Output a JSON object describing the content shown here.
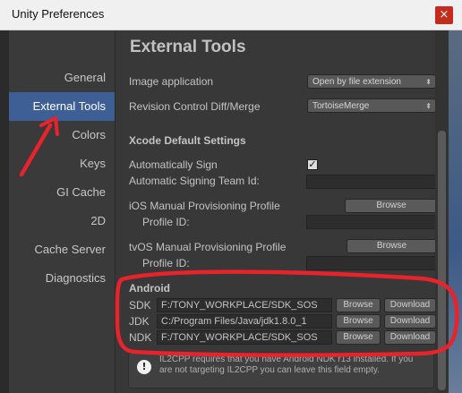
{
  "window": {
    "title": "Unity Preferences",
    "close_glyph": "×"
  },
  "sidebar": {
    "items": [
      {
        "label": "General",
        "selected": false
      },
      {
        "label": "External Tools",
        "selected": true
      },
      {
        "label": "Colors",
        "selected": false
      },
      {
        "label": "Keys",
        "selected": false
      },
      {
        "label": "GI Cache",
        "selected": false
      },
      {
        "label": "2D",
        "selected": false
      },
      {
        "label": "Cache Server",
        "selected": false
      },
      {
        "label": "Diagnostics",
        "selected": false
      }
    ]
  },
  "main": {
    "title": "External Tools",
    "image_application": {
      "label": "Image application",
      "value": "Open by file extension"
    },
    "revision_control": {
      "label": "Revision Control Diff/Merge",
      "value": "TortoiseMerge"
    },
    "xcode": {
      "heading": "Xcode Default Settings",
      "auto_sign_label": "Automatically Sign",
      "auto_sign_checked": true,
      "check_glyph": "✓",
      "team_id_label": "Automatic Signing Team Id:",
      "team_id_value": "",
      "ios_profile_label": "iOS Manual Provisioning Profile",
      "ios_profile_id_label": "Profile ID:",
      "ios_profile_id_value": "",
      "tvos_profile_label": "tvOS Manual Provisioning Profile",
      "tvos_profile_id_label": "Profile ID:",
      "tvos_profile_id_value": "",
      "browse_label": "Browse"
    },
    "android": {
      "heading": "Android",
      "rows": [
        {
          "label": "SDK",
          "path": "F:/TONY_WORKPLACE/SDK_SOS",
          "browse": "Browse",
          "download": "Download"
        },
        {
          "label": "JDK",
          "path": "C:/Program Files/Java/jdk1.8.0_1",
          "browse": "Browse",
          "download": "Download"
        },
        {
          "label": "NDK",
          "path": "F:/TONY_WORKPLACE/SDK_SOS",
          "browse": "Browse",
          "download": "Download"
        }
      ]
    },
    "warning": {
      "icon_glyph": "!",
      "text": "IL2CPP requires that you have Android NDK r13 installed. If you are not targeting IL2CPP you can leave this field empty."
    }
  },
  "colors": {
    "selected_item": "#3e5f96",
    "annotation": "#e8232b"
  }
}
